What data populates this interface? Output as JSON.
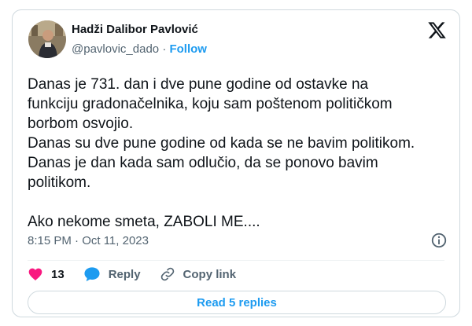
{
  "author": {
    "name": "Hadži Dalibor Pavlović",
    "handle": "@pavlovic_dado",
    "separator": "·",
    "follow_label": "Follow"
  },
  "brand": {
    "logo_icon": "x-logo-icon"
  },
  "tweet": {
    "lines": [
      "Danas je 731. dan i dve pune godine od ostavke na",
      "funkciju gradonačelnika, koju sam poštenom političkom",
      "borbom osvojio.",
      "Danas su dve pune godine od kada se ne bavim politikom.",
      "Danas je dan kada sam odlučio, da se ponovo bavim",
      "politikom.",
      "Ako nekome smeta, ZABOLI ME...."
    ],
    "timestamp": "8:15 PM · Oct 11, 2023"
  },
  "actions": {
    "like_count": "13",
    "reply_label": "Reply",
    "copy_link_label": "Copy link"
  },
  "replies_button": {
    "label": "Read 5 replies"
  },
  "colors": {
    "accent": "#1d9bf0",
    "like": "#f91880",
    "text": "#0f1419",
    "secondary": "#536471",
    "border": "#cfd9de"
  },
  "icons": [
    "avatar",
    "x-logo-icon",
    "info-icon",
    "heart-icon",
    "reply-bubble-icon",
    "link-icon"
  ]
}
